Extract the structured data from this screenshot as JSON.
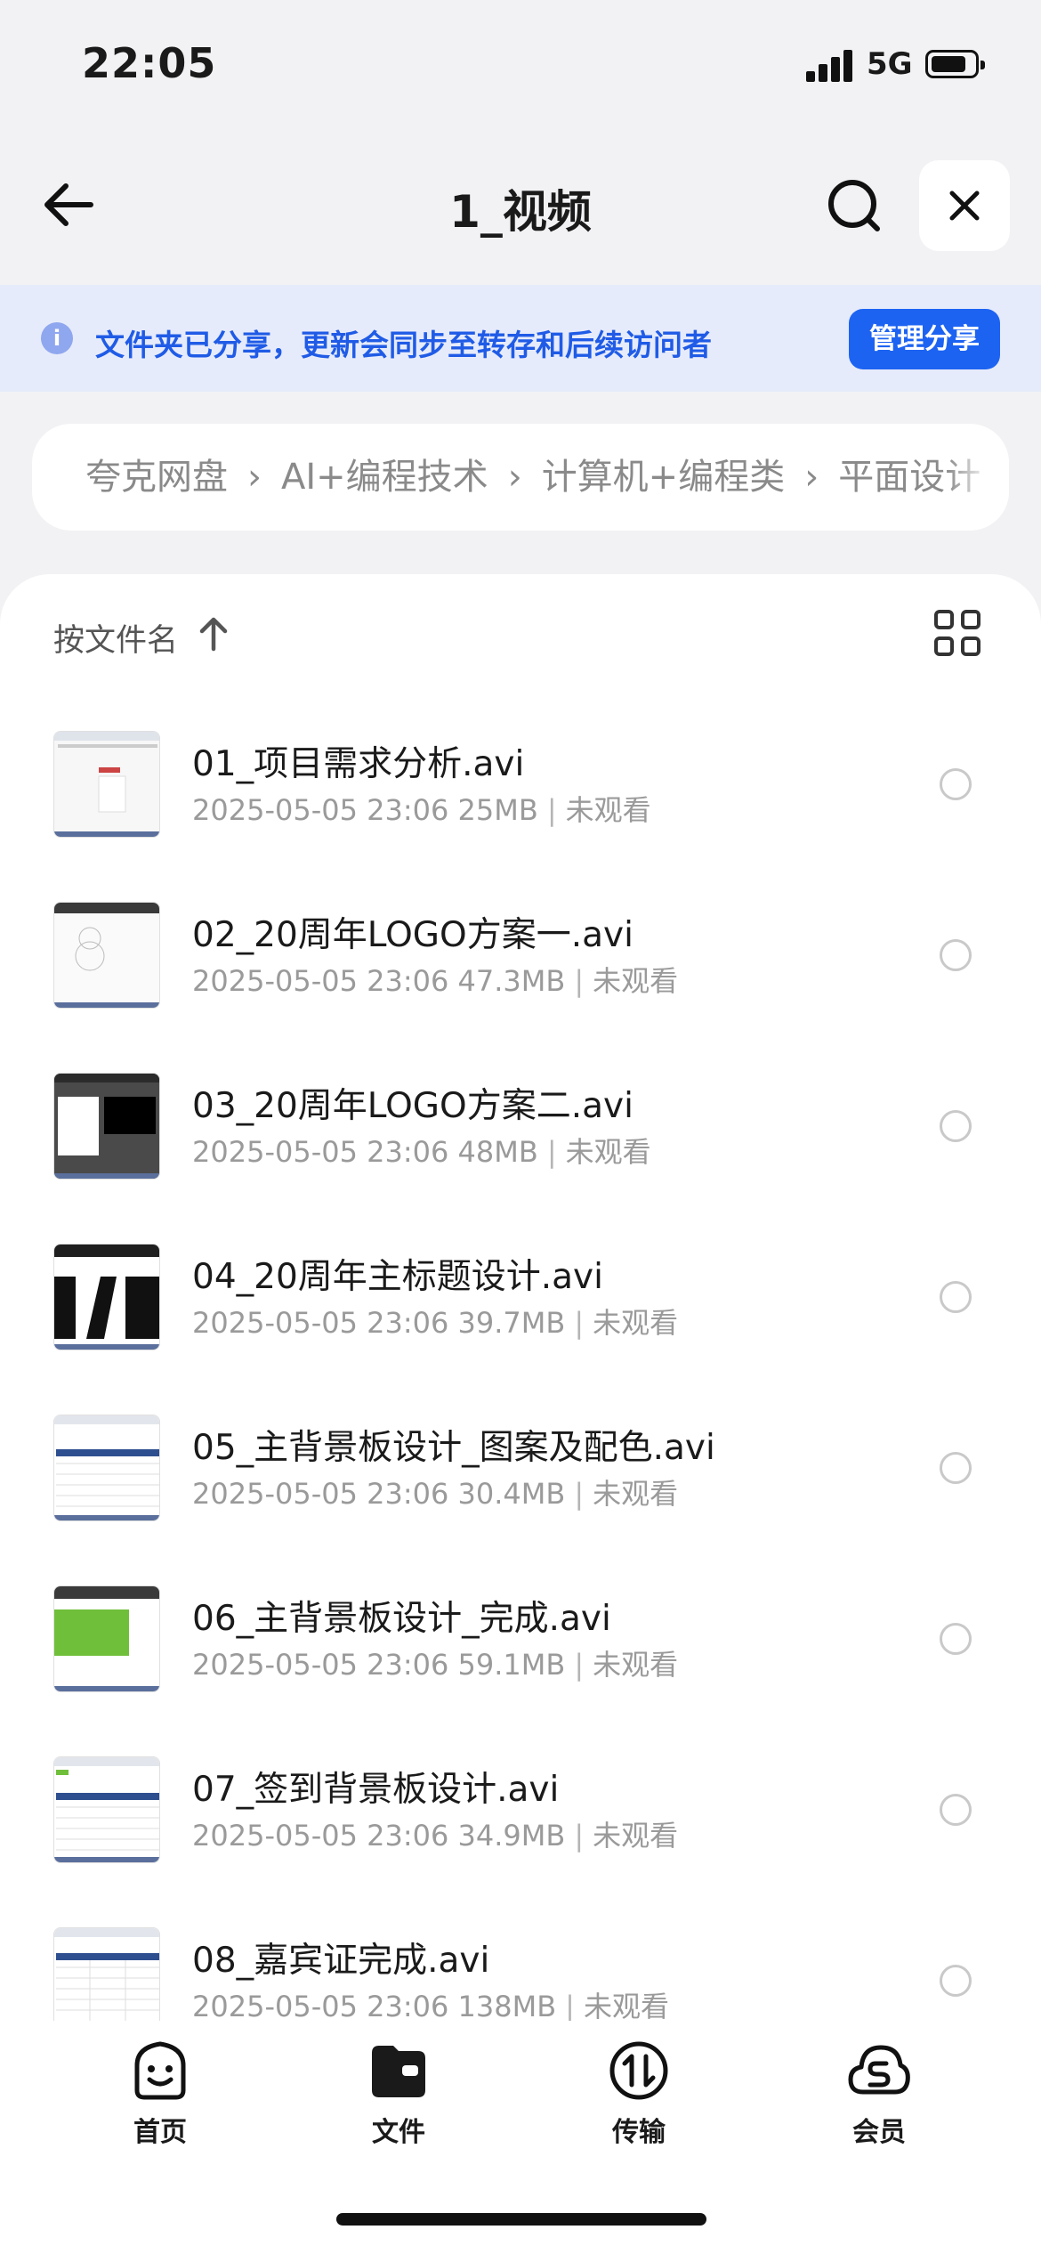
{
  "status_bar": {
    "time": "22:05",
    "network": "5G"
  },
  "nav": {
    "title": "1_视频"
  },
  "share_banner": {
    "text": "文件夹已分享，更新会同步至转存和后续访问者",
    "button": "管理分享"
  },
  "breadcrumb": [
    "夸克网盘",
    "AI+编程技术",
    "计算机+编程类",
    "平面设计"
  ],
  "sort": {
    "label": "按文件名"
  },
  "files": [
    {
      "name": "01_项目需求分析.avi",
      "date": "2025-05-05 23:06",
      "size": "25MB",
      "status": "未观看"
    },
    {
      "name": "02_20周年LOGO方案一.avi",
      "date": "2025-05-05 23:06",
      "size": "47.3MB",
      "status": "未观看"
    },
    {
      "name": "03_20周年LOGO方案二.avi",
      "date": "2025-05-05 23:06",
      "size": "48MB",
      "status": "未观看"
    },
    {
      "name": "04_20周年主标题设计.avi",
      "date": "2025-05-05 23:06",
      "size": "39.7MB",
      "status": "未观看"
    },
    {
      "name": "05_主背景板设计_图案及配色.avi",
      "date": "2025-05-05 23:06",
      "size": "30.4MB",
      "status": "未观看"
    },
    {
      "name": "06_主背景板设计_完成.avi",
      "date": "2025-05-05 23:06",
      "size": "59.1MB",
      "status": "未观看"
    },
    {
      "name": "07_签到背景板设计.avi",
      "date": "2025-05-05 23:06",
      "size": "34.9MB",
      "status": "未观看"
    },
    {
      "name": "08_嘉宾证完成.avi",
      "date": "2025-05-05 23:06",
      "size": "138MB",
      "status": "未观看"
    }
  ],
  "tabs": [
    {
      "label": "首页",
      "icon": "smiley-home-icon"
    },
    {
      "label": "文件",
      "icon": "folder-icon"
    },
    {
      "label": "传输",
      "icon": "transfer-icon"
    },
    {
      "label": "会员",
      "icon": "cloud-member-icon"
    }
  ],
  "colors": {
    "accent": "#1c63f2",
    "banner_bg": "#e6ebfb",
    "banner_text": "#1f5be6"
  }
}
